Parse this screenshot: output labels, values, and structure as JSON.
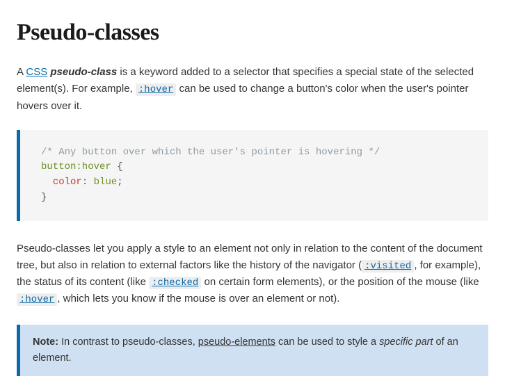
{
  "title": "Pseudo-classes",
  "intro": {
    "t1": "A ",
    "css_link": "CSS",
    "t2": " ",
    "term": "pseudo-class",
    "t3": " is a keyword added to a selector that specifies a special state of the selected element(s). For example, ",
    "hover_code": ":hover",
    "t4": " can be used to change a button's color when the user's pointer hovers over it."
  },
  "code": {
    "comment": "/* Any button over which the user's pointer is hovering */",
    "selector": "button:hover",
    "brace_open": " {",
    "indent": "  ",
    "prop": "color",
    "colon": ": ",
    "value": "blue",
    "semi": ";",
    "brace_close": "}"
  },
  "para2": {
    "t1": "Pseudo-classes let you apply a style to an element not only in relation to the content of the document tree, but also in relation to external factors like the history of the navigator (",
    "visited_code": ":visited",
    "t2": ", for example), the status of its content (like ",
    "checked_code": ":checked",
    "t3": " on certain form elements), or the position of the mouse (like ",
    "hover_code": ":hover",
    "t4": ", which lets you know if the mouse is over an element or not)."
  },
  "note": {
    "label": "Note:",
    "t1": " In contrast to pseudo-classes, ",
    "link": "pseudo-elements",
    "t2": " can be used to style a ",
    "em": "specific part",
    "t3": " of an element."
  }
}
